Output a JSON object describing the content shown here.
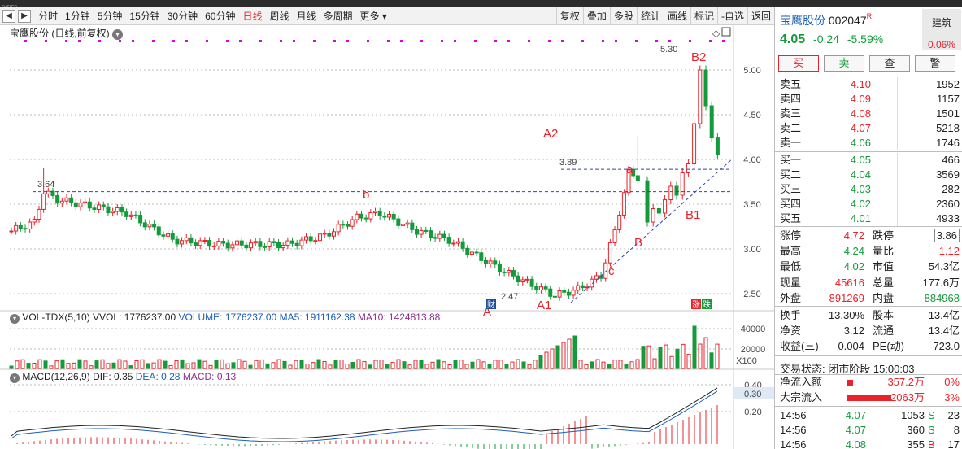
{
  "window": {
    "top_caption": "RITIES"
  },
  "toolbar": {
    "periods": [
      {
        "label": "分时",
        "active": false
      },
      {
        "label": "1分钟",
        "active": false
      },
      {
        "label": "5分钟",
        "active": false
      },
      {
        "label": "15分钟",
        "active": false
      },
      {
        "label": "30分钟",
        "active": false
      },
      {
        "label": "60分钟",
        "active": false
      },
      {
        "label": "日线",
        "active": true
      },
      {
        "label": "周线",
        "active": false
      },
      {
        "label": "月线",
        "active": false
      },
      {
        "label": "多周期",
        "active": false
      },
      {
        "label": "更多 ▾",
        "active": false
      }
    ],
    "tools": [
      "复权",
      "叠加",
      "多股",
      "统计",
      "画线",
      "标记",
      "-自选",
      "返回"
    ]
  },
  "chart": {
    "title": "宝鹰股份 (日线,前复权)",
    "price_axis": [
      "5.00",
      "4.50",
      "4.00",
      "3.50",
      "3.00",
      "2.50"
    ],
    "annotations": {
      "high_label": "5.30",
      "a2_price": "3.89",
      "left_price": "3.64",
      "low_price": "2.47",
      "waves": [
        "A2",
        "A1",
        "A",
        "B2",
        "B1",
        "B",
        "a",
        "b",
        "c"
      ]
    },
    "badges": {
      "finance": "财",
      "limit": "涨",
      "fall": "跌"
    },
    "volume": {
      "header_name": "VOL-TDX(5,10)",
      "header_vvol": "VVOL: 1776237.00",
      "header_volume": "VOLUME: 1776237.00",
      "header_ma5": "MA5: 1911162.38",
      "header_ma10": "MA10: 1424813.88",
      "axis": [
        "40000",
        "20000"
      ],
      "unit": "X100"
    },
    "macd": {
      "header_name": "MACD(12,26,9)",
      "header_dif": "DIF: 0.35",
      "header_dea": "DEA: 0.28",
      "header_macd": "MACD: 0.13",
      "axis": [
        "0.40",
        "0.30",
        "0.20"
      ],
      "current": "0.30"
    }
  },
  "quote": {
    "name": "宝鹰股份",
    "code": "002047",
    "badge": "R",
    "price": "4.05",
    "change": "-0.24",
    "change_pct": "-5.59%",
    "sector": "建筑",
    "sector_pct": "0.06%",
    "buttons": [
      "买",
      "卖",
      "查",
      "警"
    ]
  },
  "order_book": {
    "asks": [
      {
        "label": "卖五",
        "price": "4.10",
        "volume": "1952",
        "dir": "up"
      },
      {
        "label": "卖四",
        "price": "4.09",
        "volume": "1157",
        "dir": "up"
      },
      {
        "label": "卖三",
        "price": "4.08",
        "volume": "1501",
        "dir": "up"
      },
      {
        "label": "卖二",
        "price": "4.07",
        "volume": "5218",
        "dir": "up"
      },
      {
        "label": "卖一",
        "price": "4.06",
        "volume": "1746",
        "dir": "dn"
      }
    ],
    "bids": [
      {
        "label": "买一",
        "price": "4.05",
        "volume": "466",
        "dir": "dn"
      },
      {
        "label": "买二",
        "price": "4.04",
        "volume": "3569",
        "dir": "dn"
      },
      {
        "label": "买三",
        "price": "4.03",
        "volume": "282",
        "dir": "dn"
      },
      {
        "label": "买四",
        "price": "4.02",
        "volume": "2360",
        "dir": "dn"
      },
      {
        "label": "买五",
        "price": "4.01",
        "volume": "4933",
        "dir": "dn"
      }
    ]
  },
  "stats_a": [
    {
      "l1": "涨停",
      "v1": "4.72",
      "c1": "up",
      "l2": "跌停",
      "v2": "3.86",
      "c2": "plain",
      "boxed": true
    },
    {
      "l1": "最高",
      "v1": "4.24",
      "c1": "dn",
      "l2": "量比",
      "v2": "1.12",
      "c2": "up",
      "boxed": false
    },
    {
      "l1": "最低",
      "v1": "4.02",
      "c1": "dn",
      "l2": "市值",
      "v2": "54.3亿",
      "c2": "plain",
      "boxed": false
    },
    {
      "l1": "现量",
      "v1": "45616",
      "c1": "up",
      "l2": "总量",
      "v2": "177.6万",
      "c2": "plain",
      "boxed": false
    },
    {
      "l1": "外盘",
      "v1": "891269",
      "c1": "up",
      "l2": "内盘",
      "v2": "884968",
      "c2": "dn",
      "boxed": false
    }
  ],
  "stats_b": [
    {
      "l1": "换手",
      "v1": "13.30%",
      "l2": "股本",
      "v2": "13.4亿"
    },
    {
      "l1": "净资",
      "v1": "3.12",
      "l2": "流通",
      "v2": "13.4亿"
    },
    {
      "l1": "收益(三)",
      "v1": "0.004",
      "l2": "PE(动)",
      "v2": "723.0"
    }
  ],
  "trade_status": "交易状态: 闭市阶段 15:00:03",
  "flows": [
    {
      "label": "净流入额",
      "value": "357.2万",
      "pct": "0%",
      "bar": 0.06
    },
    {
      "label": "大宗流入",
      "value": "2063万",
      "pct": "3%",
      "bar": 0.42
    }
  ],
  "ticks": [
    {
      "time": "14:56",
      "price": "4.07",
      "vol": "1053",
      "side": "S",
      "num": "23"
    },
    {
      "time": "14:56",
      "price": "4.07",
      "vol": "360",
      "side": "S",
      "num": "8"
    },
    {
      "time": "14:56",
      "price": "4.08",
      "vol": "355",
      "side": "B",
      "num": "17"
    }
  ]
}
